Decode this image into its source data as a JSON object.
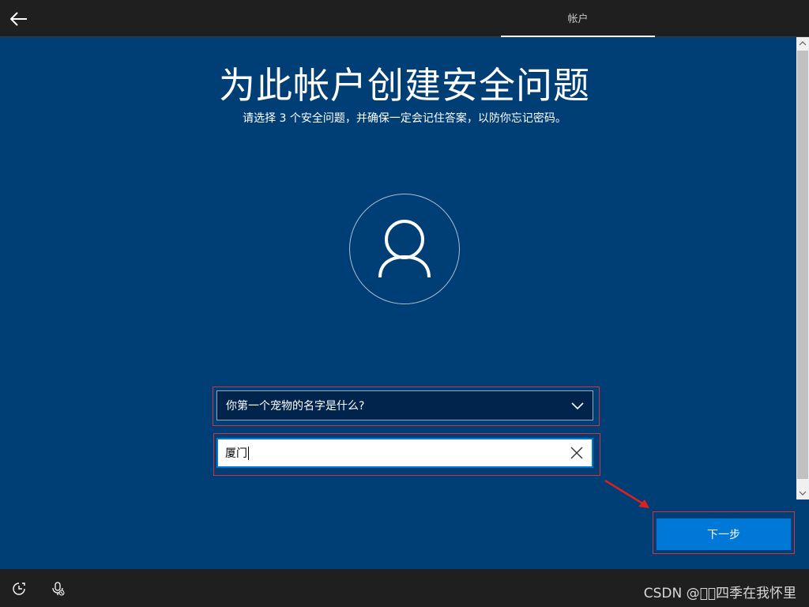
{
  "header": {
    "tab_label": "帐户"
  },
  "main": {
    "title": "为此帐户创建安全问题",
    "subtitle": "请选择 3 个安全问题，并确保一定会记住答案，以防你忘记密码。"
  },
  "form": {
    "question_selected": "你第一个宠物的名字是什么?",
    "answer_value": "厦门"
  },
  "buttons": {
    "next_label": "下一步"
  },
  "footer": {
    "watermark": "CSDN @\u0000\u0000四季在我怀里"
  },
  "icons": {
    "back": "arrow-left-icon",
    "avatar": "user-icon",
    "chevron": "chevron-down-icon",
    "clear": "close-icon",
    "ease_of_access": "ease-of-access-icon",
    "microphone": "microphone-off-icon"
  },
  "colors": {
    "page_bg": "#003e76",
    "bar_bg": "#1f1f1f",
    "accent": "#0078d7",
    "highlight_border": "#d8323c",
    "select_bg": "#00244c"
  }
}
